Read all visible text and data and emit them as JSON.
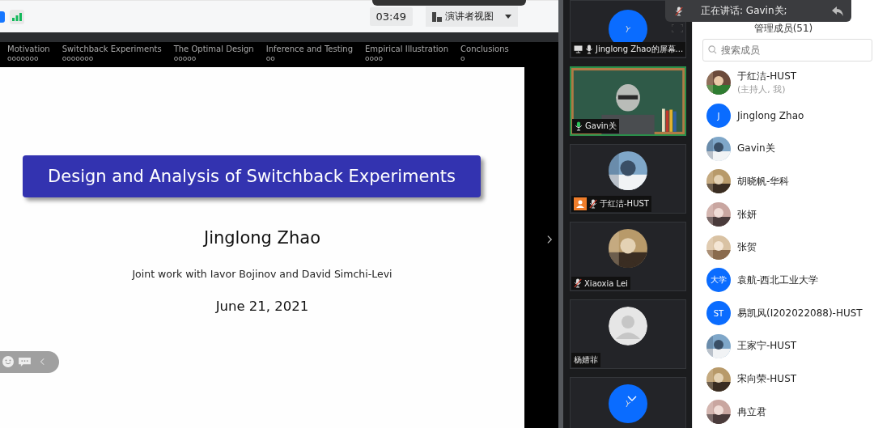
{
  "toolbar": {
    "timer": "03:49",
    "view_button": "演讲者视图"
  },
  "speaking_toast": {
    "text": "正在讲话: Gavin关;"
  },
  "slide": {
    "sections": [
      {
        "label": "Motivation",
        "dots": "ooooooo"
      },
      {
        "label": "Switchback Experiments",
        "dots": "ooooooo"
      },
      {
        "label": "The Optimal Design",
        "dots": "ooooo"
      },
      {
        "label": "Inference and Testing",
        "dots": "oo"
      },
      {
        "label": "Empirical Illustration",
        "dots": "oooo"
      },
      {
        "label": "Conclusions",
        "dots": "o"
      }
    ],
    "title": "Design and Analysis of Switchback Experiments",
    "author": "Jinglong Zhao",
    "subtitle": "Joint work with Iavor Bojinov and David Simchi-Levi",
    "date": "June 21, 2021"
  },
  "video_tiles": [
    {
      "kind": "screen_share",
      "name": "Jinglong Zhao的屏幕..."
    },
    {
      "kind": "speaker_video",
      "name": "Gavin关"
    },
    {
      "kind": "host_muted",
      "name": "于红洁-HUST"
    },
    {
      "kind": "muted",
      "name": "Xiaoxia Lei"
    },
    {
      "kind": "no_photo",
      "name": "杨婧菲"
    },
    {
      "kind": "avatar_only"
    }
  ],
  "members": {
    "title": "管理成员(51)",
    "search": {
      "placeholder": "搜索成员"
    },
    "items": [
      {
        "name": "于红洁-HUST",
        "note": "(主持人, 我)"
      },
      {
        "kind": "letter",
        "avatar_text": "J",
        "name": "Jinglong Zhao"
      },
      {
        "name": "Gavin关"
      },
      {
        "name": "胡晓帆-华科"
      },
      {
        "name": "张妍"
      },
      {
        "name": "张贺"
      },
      {
        "kind": "letter",
        "avatar_text": "大学",
        "name": "袁航-西北工业大学"
      },
      {
        "kind": "letter",
        "avatar_text": "ST",
        "name": "易凯风(I202022088)-HUST"
      },
      {
        "name": "王家宁-HUST"
      },
      {
        "name": "宋向荣-HUST"
      },
      {
        "name": "冉立君"
      }
    ]
  }
}
